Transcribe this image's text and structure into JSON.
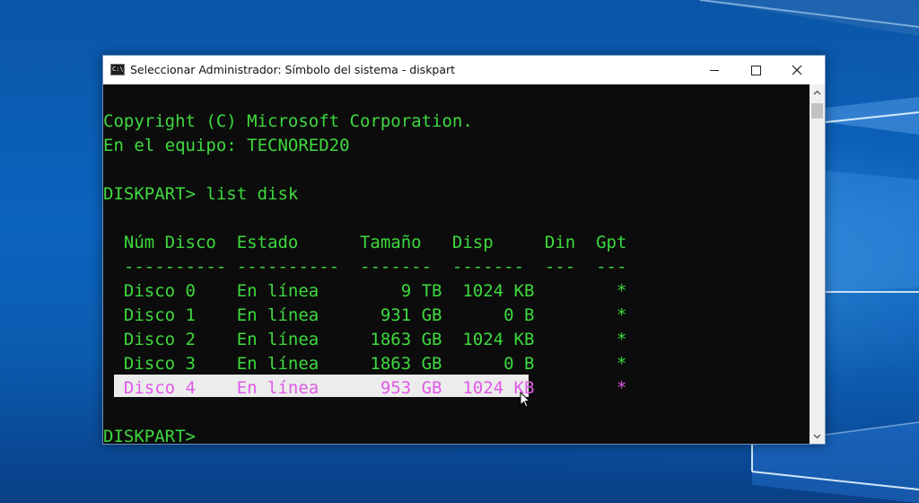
{
  "window": {
    "title": "Seleccionar Administrador: Símbolo del sistema - diskpart",
    "icon": "cmd-icon",
    "icon_text": "C:\\."
  },
  "controls": {
    "minimize": "minimize-icon",
    "maximize": "maximize-icon",
    "close": "close-icon"
  },
  "console": {
    "text_color": "#3ed93e",
    "selected_text_color": "#e05ae8",
    "selection_bg": "#ececec",
    "lines": [
      "Copyright (C) Microsoft Corporation.",
      "En el equipo: TECNORED20",
      "DISKPART> list disk",
      "  Núm Disco  Estado      Tamaño   Disp     Din  Gpt",
      "  ---------- ----------  -------  -------  ---  ---",
      "  Disco 0    En línea        9 TB  1024 KB        *",
      "  Disco 1    En línea      931 GB      0 B        *",
      "  Disco 2    En línea     1863 GB  1024 KB        *",
      "  Disco 3    En línea     1863 GB      0 B        *",
      "  Disco 4    En línea      953 GB  1024 KB        *",
      "DISKPART>"
    ]
  },
  "scrollbar": {
    "up": "arrow-up-icon",
    "down": "arrow-down-icon"
  }
}
